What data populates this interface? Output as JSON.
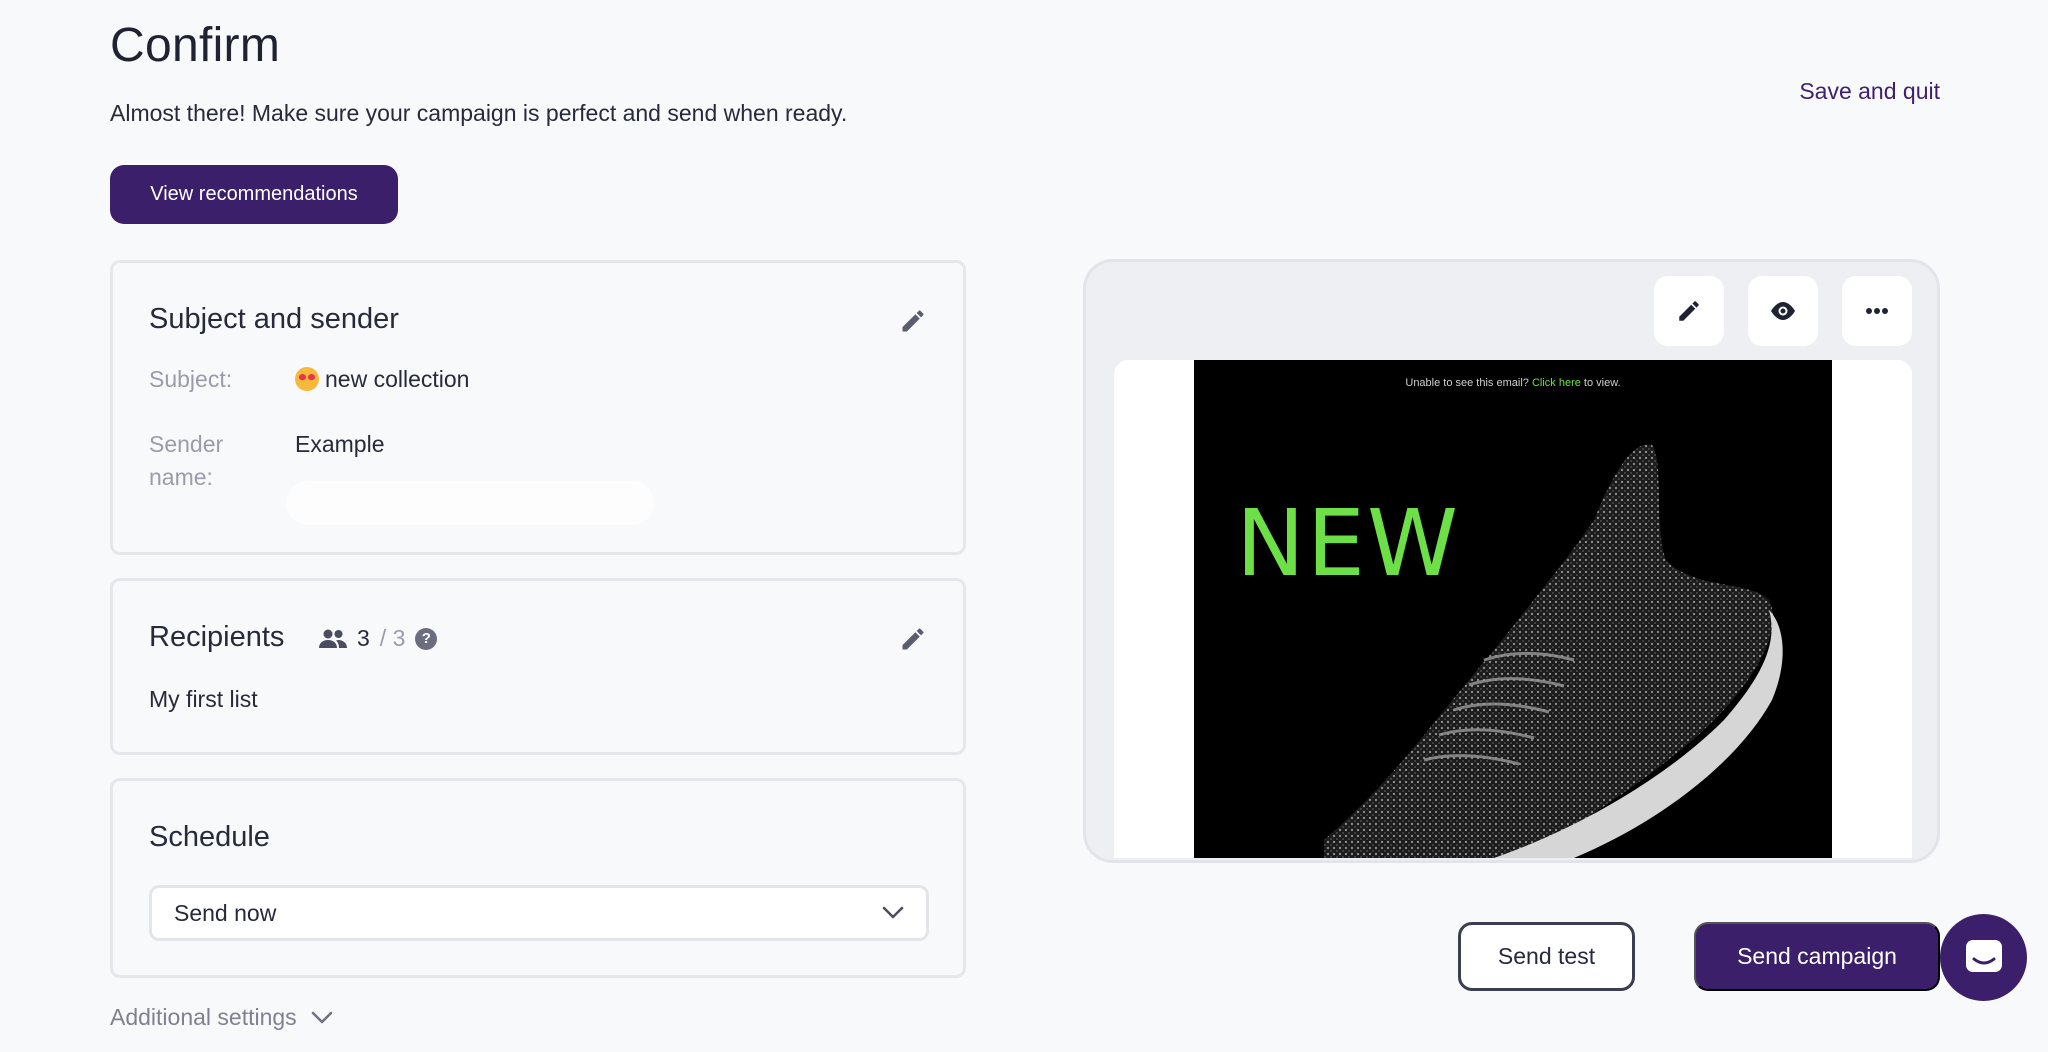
{
  "page": {
    "title": "Confirm",
    "subtitle": "Almost there! Make sure your campaign is perfect and send when ready.",
    "save_quit_label": "Save and quit",
    "view_recommendations_label": "View recommendations"
  },
  "subject_card": {
    "title": "Subject and sender",
    "subject_label": "Subject:",
    "subject_value": "new collection",
    "sender_label_line1": "Sender",
    "sender_label_line2": "name:",
    "sender_value": "Example"
  },
  "recipients_card": {
    "title": "Recipients",
    "count": "3",
    "total": "/ 3",
    "list_name": "My first list"
  },
  "schedule_card": {
    "title": "Schedule",
    "selected_option": "Send now"
  },
  "additional_settings_label": "Additional settings",
  "preview": {
    "top_text_prefix": "Unable to see this email?",
    "top_text_link": "Click here",
    "top_text_suffix": "to view.",
    "headline": "NEW",
    "tools": [
      "pencil-icon",
      "eye-icon",
      "more-icon"
    ]
  },
  "actions": {
    "send_test_label": "Send test",
    "send_campaign_label": "Send campaign"
  },
  "colors": {
    "brand": "#3c1f6b",
    "accent_green": "#6ee047",
    "background": "#f8f9fb"
  }
}
